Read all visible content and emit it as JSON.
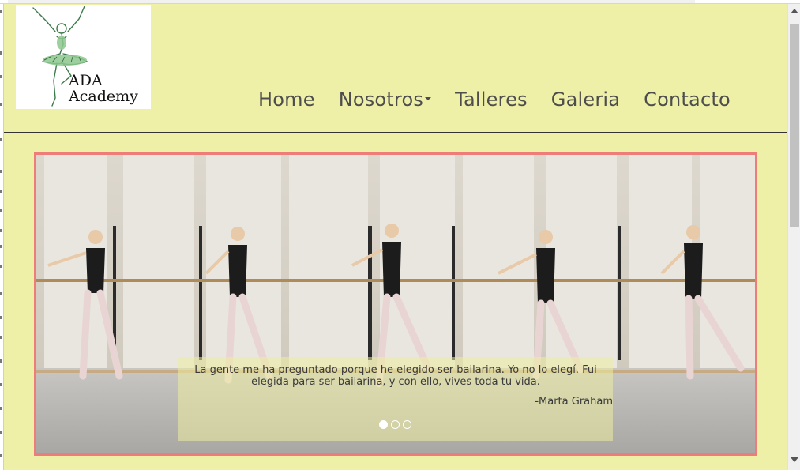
{
  "site": {
    "logo": {
      "line1": "ADA",
      "line2": "Academy",
      "icon": "ballerina-logo-icon"
    },
    "nav": {
      "items": [
        {
          "label": "Home"
        },
        {
          "label": "Nosotros",
          "has_dropdown": true
        },
        {
          "label": "Talleres"
        },
        {
          "label": "Galeria"
        },
        {
          "label": "Contacto"
        }
      ]
    }
  },
  "carousel": {
    "image": "ballet-dancers-at-barre-photo",
    "caption": {
      "quote": "La gente me ha preguntado porque he elegido ser bailarina. Yo no lo elegí. Fui elegida para ser bailarina, y con ello, vives toda tu vida.",
      "author": "-Marta Graham"
    },
    "slides": 3,
    "active_slide": 1
  },
  "colors": {
    "page_background": "#eff0a8",
    "carousel_border": "#ee7c78",
    "nav_text": "#4d4d4d"
  },
  "scrollbar": {
    "position": "top"
  }
}
